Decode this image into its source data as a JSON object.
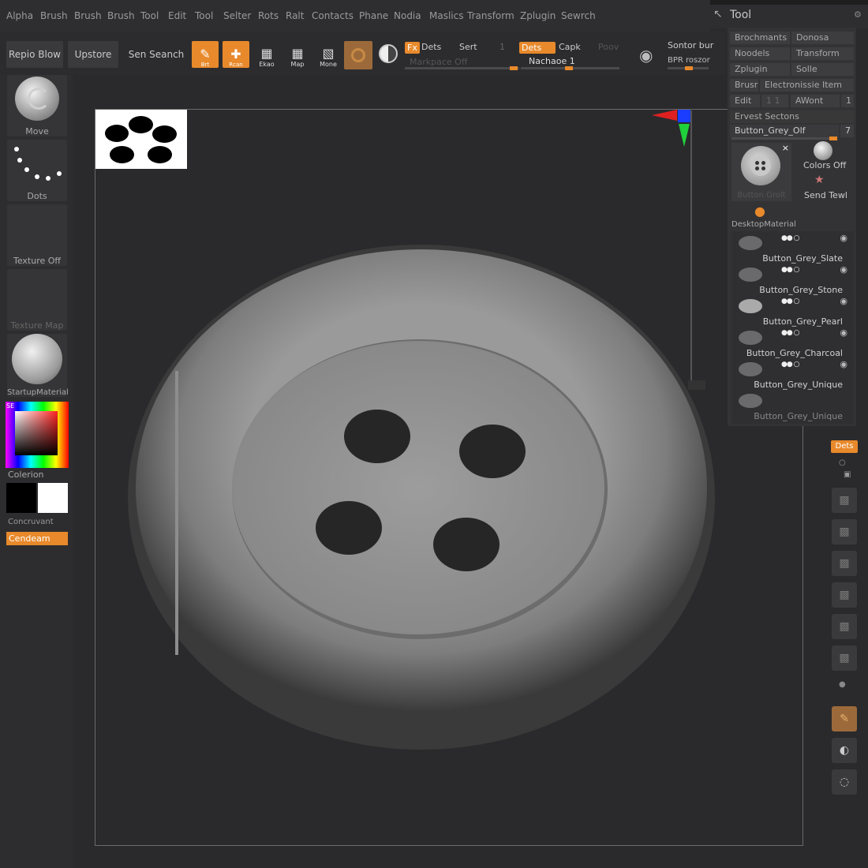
{
  "menu": [
    "Alpha",
    "Brush",
    "Brush",
    "Brush",
    "Tool",
    "Edit",
    "Tool",
    "Selter",
    "Rots",
    "Ralt",
    "Contacts",
    "Phane",
    "Nodia",
    "Maslics",
    "Transform",
    "Zplugin",
    "Sewrch"
  ],
  "tool_panel_title": "Tool",
  "toolbar": {
    "btn1": "Repio Blow",
    "btn2": "Upstore",
    "btn3": "Sen Seanch",
    "draw_label": "Brt",
    "move_label": "Rcan",
    "b3_label": "Ekao",
    "b4_label": "Map",
    "b5_label": "Mone",
    "tag1": "Fx",
    "dets1": "Dets",
    "sert": "Sert",
    "one": "1",
    "tag2": "Dets",
    "capk": "Capk",
    "poov": "Poov",
    "markpace": "Markpace Off",
    "nachaoe": "Nachaoe 1",
    "sontor": "Sontor bur",
    "bpr": "BPR roszor"
  },
  "left_shelf": {
    "move": "Move",
    "dots": "Dots",
    "texture1": "Texture Off",
    "texture2": "Texture Map",
    "startup": "StartupMaterial",
    "color_badge": "SE",
    "colorion": "Colerion",
    "concruvant": "Concruvant",
    "cendeam": "Cendeam"
  },
  "right_panel": {
    "r1a": "Brochmants",
    "r1b": "Donosa",
    "r2a": "Noodels",
    "r2b": "Transform",
    "r3a": "Zplugin",
    "r3b": "Solle",
    "r4a": "Brusr",
    "r4b": "Electronissie Item",
    "r5a": "Edit",
    "r5b": "1 1",
    "r5c": "AWont",
    "r5d": "1",
    "r6": "Ervest Sectons",
    "current_tool": "Button_Grey_Olf",
    "tool_number": "7",
    "thumb_label": "Button Grolt",
    "colors_off": "Colors Off",
    "send_tewl": "Send Tewl",
    "material": "DesktopMaterial",
    "subtools": [
      "Button_Grey_Slate",
      "Button_Grey_Stone",
      "Button_Grey_Pearl",
      "Button_Grey_Charcoal",
      "Button_Grey_Unique",
      "Button_Grey_Unique"
    ]
  },
  "right_strip": {
    "dets": "Dets"
  }
}
